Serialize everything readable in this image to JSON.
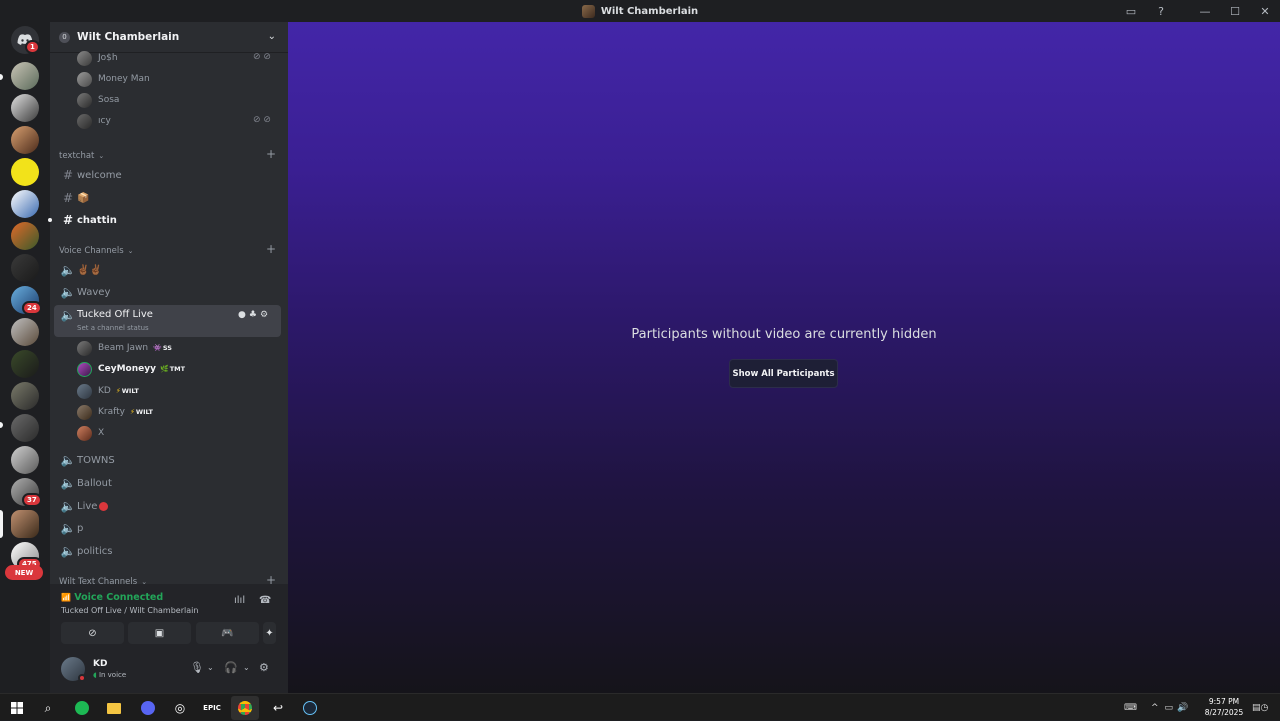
{
  "window": {
    "title": "Wilt Chamberlain"
  },
  "guild_badges": {
    "home": "1",
    "g1": "24",
    "g2": "37",
    "g3": "475",
    "new": "NEW"
  },
  "server": {
    "name": "Wilt Chamberlain",
    "icon_letter": "0"
  },
  "members_top": [
    {
      "name": "Jo$h",
      "muted": true
    },
    {
      "name": "Money Man",
      "muted": false
    },
    {
      "name": "Sosa",
      "muted": false
    },
    {
      "name": "ıcy",
      "muted": true
    }
  ],
  "categories": {
    "textchat": "textchat",
    "voice": "Voice Channels",
    "wilt_text": "Wilt Text Channels"
  },
  "text_channels": [
    "welcome",
    "📦",
    "chattin"
  ],
  "voice_channels": {
    "first": "✌🏾✌🏾",
    "second": "Wavey",
    "active": "Tucked Off Live",
    "active_status": "Set a channel status",
    "after": [
      "TOWNS",
      "Ballout",
      "Live",
      "p",
      "politics"
    ]
  },
  "voice_members": [
    {
      "name": "Beam Jawn",
      "tag": "SS",
      "tag_icon": "👾"
    },
    {
      "name": "CeyMoneyy",
      "tag": "TMT",
      "tag_icon": "🌿"
    },
    {
      "name": "KD",
      "tag": "WILT",
      "tag_icon": "⚡"
    },
    {
      "name": "Krafty",
      "tag": "WILT",
      "tag_icon": "⚡"
    },
    {
      "name": "X",
      "tag": "",
      "tag_icon": ""
    }
  ],
  "voice_panel": {
    "status": "Voice Connected",
    "location": "Tucked Off Live / Wilt Chamberlain"
  },
  "user": {
    "name": "KD",
    "status": "In voice"
  },
  "stage": {
    "message": "Participants without video are currently hidden",
    "button": "Show All Participants"
  },
  "taskbar": {
    "time": "9:57 PM",
    "date": "8/27/2025"
  },
  "colors": {
    "accent_green": "#23a559",
    "danger": "#da373c",
    "stage_top": "#4326a8"
  }
}
